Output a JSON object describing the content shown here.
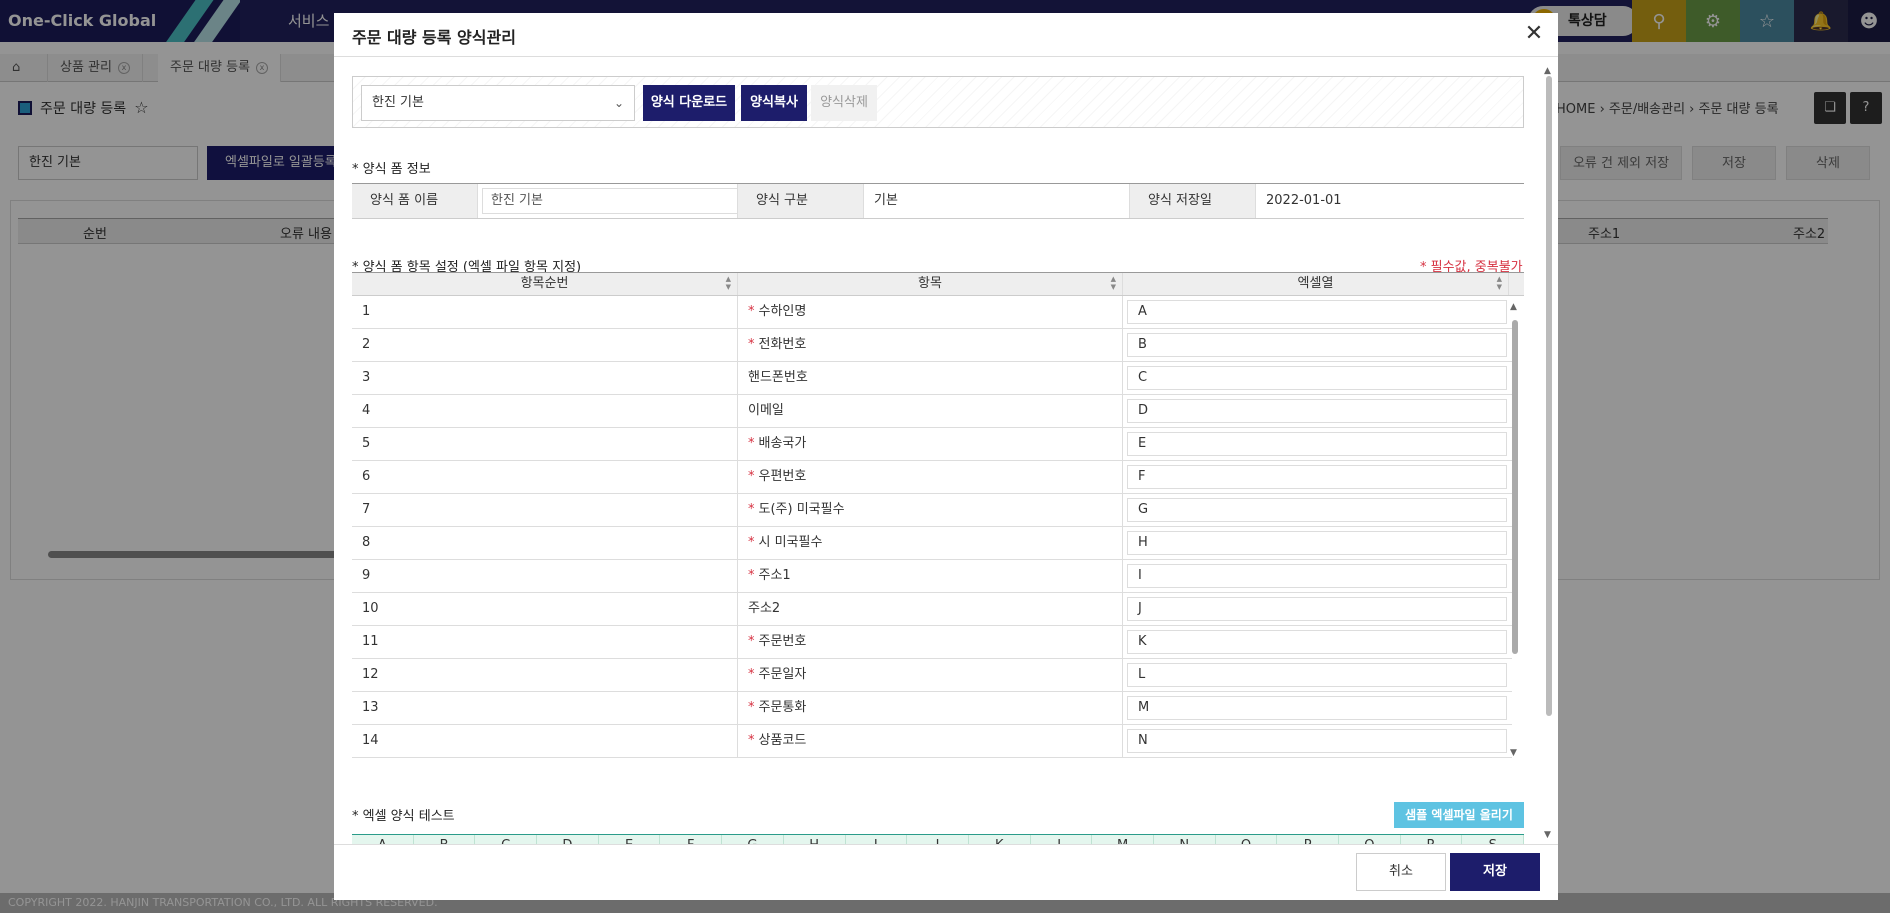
{
  "app": {
    "brand": "One-Click Global",
    "menu_text": "서비스 안",
    "chat_label": "톡상담",
    "tabs": [
      {
        "label": "상품 관리"
      },
      {
        "label": "주문 대량 등록"
      }
    ],
    "page_title": "주문 대량 등록",
    "breadcrumb": "HOME  ›  주문/배송관리  ›  주문 대량 등록",
    "select_value": "한진 기본",
    "excel_button": "엑셀파일로 일괄등록",
    "btn_save_except": "오류 건 제외 저장",
    "btn_save": "저장",
    "btn_delete": "삭제",
    "grid_headers": {
      "seq": "순번",
      "error": "오류 내용",
      "addr1": "주소1",
      "addr2": "주소2"
    },
    "copyright": "COPYRIGHT 2022. HANJIN TRANSPORTATION CO., LTD. ALL RIGHTS RESERVED."
  },
  "modal": {
    "title": "주문 대량 등록 양식관리",
    "toolbar": {
      "template_select": "한진 기본",
      "download_label": "양식 다운로드",
      "copy_label": "양식복사",
      "delete_label": "양식삭제"
    },
    "form_info": {
      "section_label": "* 양식 폼 정보",
      "name_label": "양식 폼 이름",
      "name_value": "한진 기본",
      "type_label": "양식 구분",
      "type_value": "기본",
      "date_label": "양식 저장일",
      "date_value": "2022-01-01"
    },
    "items": {
      "section_label": "* 양식 폼 항목 설정 (엑셀 파일 항목 지정)",
      "required_note": "* 필수값, 중복불가",
      "headers": {
        "seq": "항목순번",
        "item": "항목",
        "column": "엑셀열"
      },
      "rows": [
        {
          "seq": "1",
          "item": "수하인명",
          "required": true,
          "column": "A"
        },
        {
          "seq": "2",
          "item": "전화번호",
          "required": true,
          "column": "B"
        },
        {
          "seq": "3",
          "item": "핸드폰번호",
          "required": false,
          "column": "C"
        },
        {
          "seq": "4",
          "item": "이메일",
          "required": false,
          "column": "D"
        },
        {
          "seq": "5",
          "item": "배송국가",
          "required": true,
          "column": "E"
        },
        {
          "seq": "6",
          "item": "우편번호",
          "required": true,
          "column": "F"
        },
        {
          "seq": "7",
          "item": "도(주) 미국필수",
          "required": true,
          "column": "G"
        },
        {
          "seq": "8",
          "item": "시 미국필수",
          "required": true,
          "column": "H"
        },
        {
          "seq": "9",
          "item": "주소1",
          "required": true,
          "column": "I"
        },
        {
          "seq": "10",
          "item": "주소2",
          "required": false,
          "column": "J"
        },
        {
          "seq": "11",
          "item": "주문번호",
          "required": true,
          "column": "K"
        },
        {
          "seq": "12",
          "item": "주문일자",
          "required": true,
          "column": "L"
        },
        {
          "seq": "13",
          "item": "주문통화",
          "required": true,
          "column": "M"
        },
        {
          "seq": "14",
          "item": "상품코드",
          "required": true,
          "column": "N"
        }
      ]
    },
    "test": {
      "section_label": "* 엑셀 양식 테스트",
      "upload_label": "샘플 엑셀파일 올리기",
      "columns": [
        "A",
        "B",
        "C",
        "D",
        "E",
        "F",
        "G",
        "H",
        "I",
        "J",
        "K",
        "L",
        "M",
        "N",
        "O",
        "P",
        "Q",
        "R",
        "S"
      ]
    },
    "footer": {
      "cancel_label": "취소",
      "save_label": "저장"
    }
  }
}
